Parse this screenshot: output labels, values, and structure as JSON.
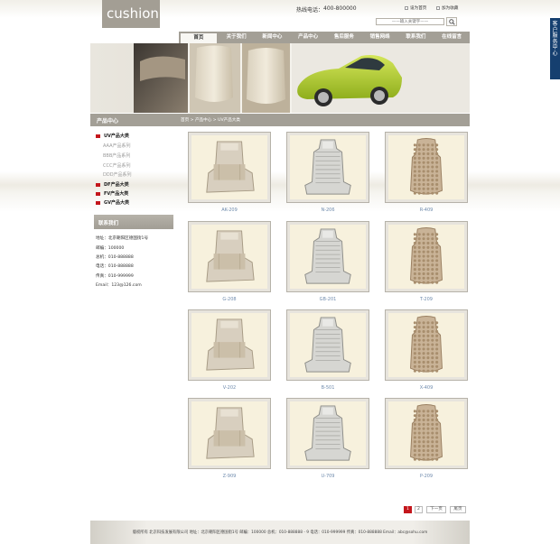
{
  "header": {
    "logo": "cushion",
    "hotline_label": "热线电话：",
    "hotline_number": "400-800000",
    "set_homepage": "设为首页",
    "add_favorite": "加为收藏",
    "search_placeholder": "——输入关键字——"
  },
  "nav": [
    "首页",
    "关于我们",
    "新闻中心",
    "产品中心",
    "售后服务",
    "销售网络",
    "联系我们",
    "在线留言"
  ],
  "side_tab": [
    "客",
    "户",
    "服",
    "务",
    "中",
    "心"
  ],
  "section": {
    "title": "产品中心",
    "breadcrumb": "首页 > 产品中心 > UV产品大类"
  },
  "categories": [
    {
      "label": "UV产品大类",
      "type": "main"
    },
    {
      "label": "AAA产品系列",
      "type": "sub"
    },
    {
      "label": "BBB产品系列",
      "type": "sub"
    },
    {
      "label": "CCC产品系列",
      "type": "sub"
    },
    {
      "label": "DDD产品系列",
      "type": "sub"
    },
    {
      "label": "DF产品大类",
      "type": "main"
    },
    {
      "label": "FV产品大类",
      "type": "main"
    },
    {
      "label": "GV产品大类",
      "type": "main"
    }
  ],
  "contact": {
    "title": "联系我们",
    "lines": [
      "地址：北京朝阳区德国街1号",
      "邮编：100000",
      "总机：010-888888",
      "电话：010-888888",
      "传真：010-999999",
      "Email：123@126.com"
    ]
  },
  "products": [
    {
      "code": "AK-209",
      "style": "flat"
    },
    {
      "code": "N-206",
      "style": "mesh"
    },
    {
      "code": "R-409",
      "style": "bead"
    },
    {
      "code": "G-208",
      "style": "flat"
    },
    {
      "code": "GB-201",
      "style": "mesh"
    },
    {
      "code": "T-209",
      "style": "bead"
    },
    {
      "code": "V-202",
      "style": "flat"
    },
    {
      "code": "B-501",
      "style": "mesh"
    },
    {
      "code": "X-409",
      "style": "bead"
    },
    {
      "code": "Z-909",
      "style": "flat"
    },
    {
      "code": "U-709",
      "style": "mesh"
    },
    {
      "code": "P-209",
      "style": "bead"
    }
  ],
  "pagination": {
    "pages": [
      "1",
      "2"
    ],
    "current": "1",
    "next": "下一页",
    "last": "尾页"
  },
  "footer": {
    "text": "版权所有  北京科技发展有限公司  地址：北京朝阳区德国街1号  邮编：100000  总机：010-888888 - 9  电话：010-999999  传真：010-888888  Email：abc@sohu.com"
  },
  "colors": {
    "bar": "#a39f96",
    "accent_red": "#c4161c",
    "caption_blue": "#6f8bad",
    "side_tab": "#153f6f",
    "car_green": "#a8c72a"
  }
}
